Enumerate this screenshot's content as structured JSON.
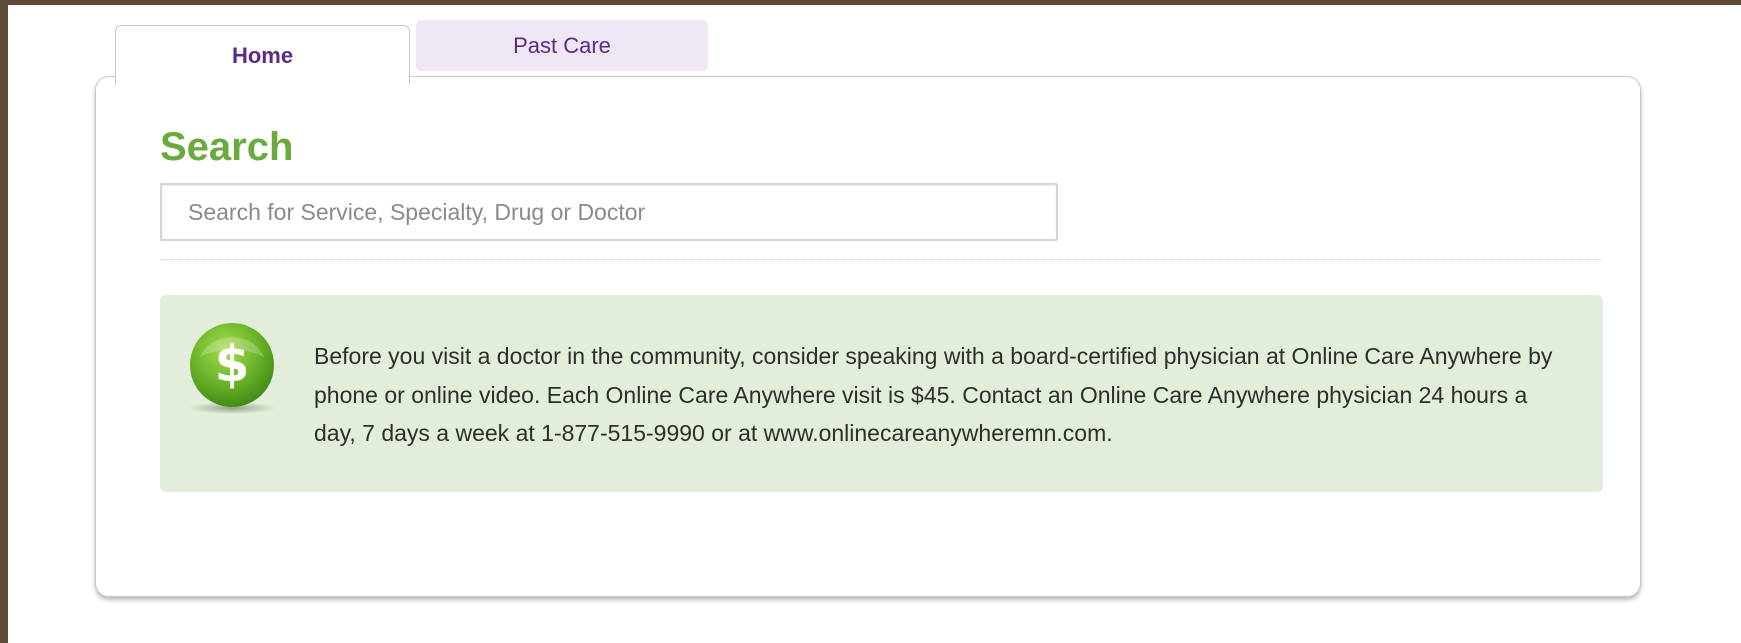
{
  "tabs": [
    {
      "label": "Home",
      "active": true
    },
    {
      "label": "Past Care",
      "active": false
    }
  ],
  "search": {
    "title": "Search",
    "placeholder": "Search for Service, Specialty, Drug or Doctor",
    "value": ""
  },
  "promo": {
    "icon": "dollar-sign-icon",
    "text": "Before you visit a doctor in the community, consider speaking with a board-certified physician at Online Care Anywhere by phone or online video. Each Online Care Anywhere visit is $45. Contact an Online Care Anywhere physician 24 hours a day, 7 days a week at 1-877-515-9990 or at www.onlinecareanywheremn.com."
  },
  "colors": {
    "accent_green": "#6aaa3f",
    "tab_purple": "#5b2a86",
    "promo_background": "#e2eed9",
    "inactive_tab_background": "#efe7f4"
  }
}
